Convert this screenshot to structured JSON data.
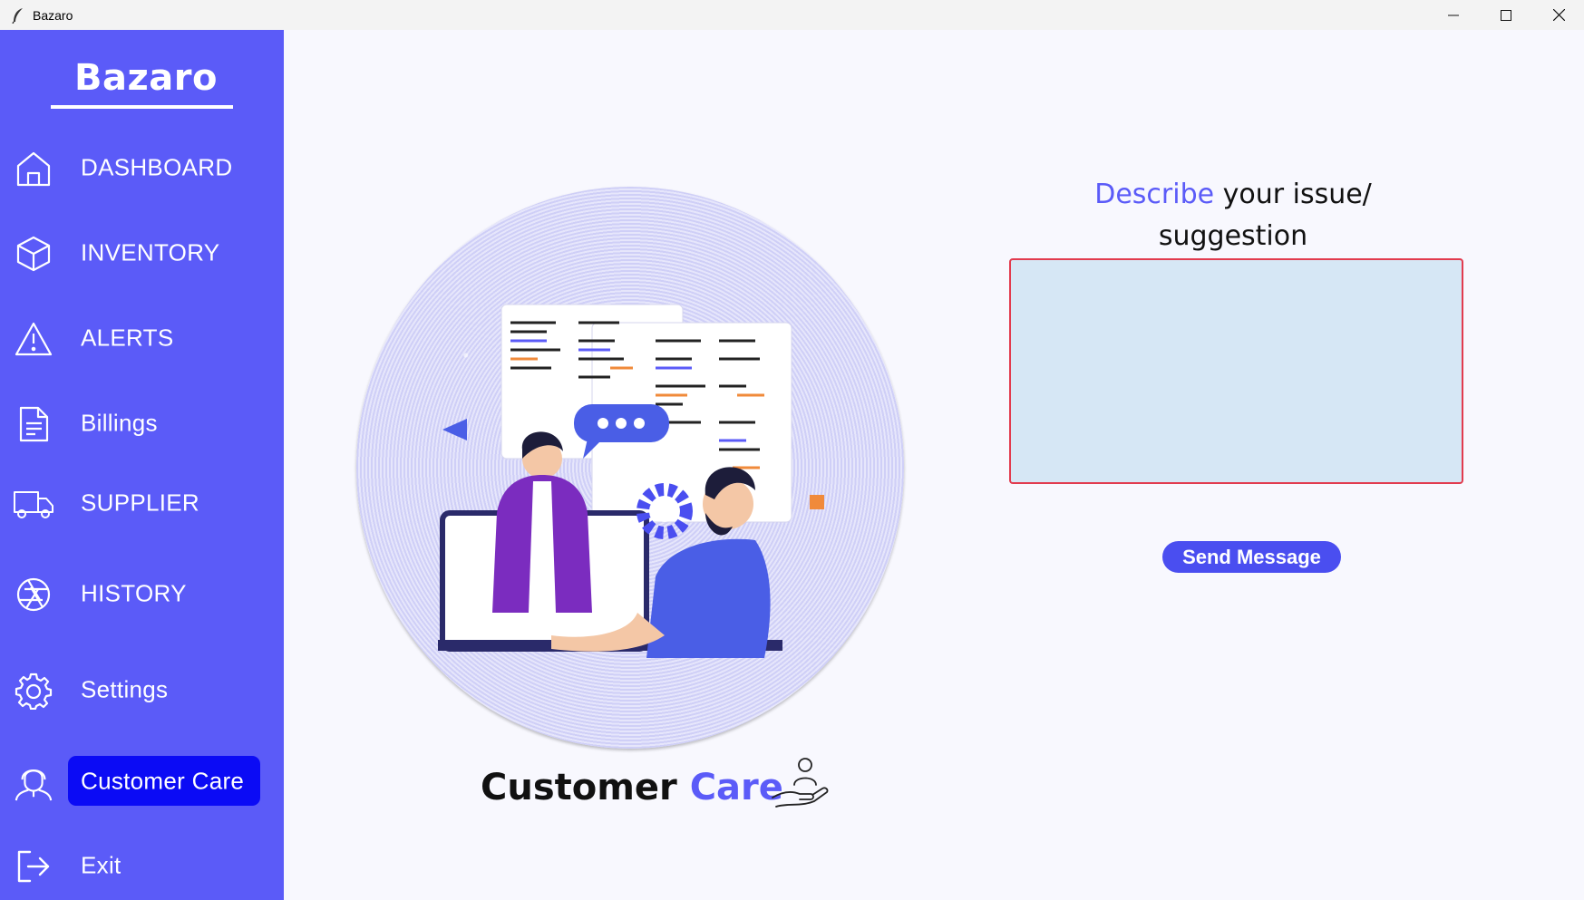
{
  "window": {
    "title": "Bazaro",
    "controls": [
      "minimize-icon",
      "maximize-icon",
      "close-icon"
    ]
  },
  "sidebar": {
    "brand": "Bazaro",
    "items": [
      {
        "label": "DASHBOARD",
        "icon": "home-icon",
        "active": false
      },
      {
        "label": "INVENTORY",
        "icon": "cube-icon",
        "active": false
      },
      {
        "label": "ALERTS",
        "icon": "warning-icon",
        "active": false
      },
      {
        "label": "Billings",
        "icon": "document-icon",
        "active": false
      },
      {
        "label": "SUPPLIER",
        "icon": "truck-icon",
        "active": false
      },
      {
        "label": "HISTORY",
        "icon": "aperture-icon",
        "active": false
      },
      {
        "label": "Settings",
        "icon": "gear-icon",
        "active": false
      },
      {
        "label": "Customer Care",
        "icon": "support-agent-icon",
        "active": true
      },
      {
        "label": "Exit",
        "icon": "logout-icon",
        "active": false
      }
    ]
  },
  "main": {
    "caption_part1": "Customer ",
    "caption_part2": "Care",
    "prompt_accent": "Describe",
    "prompt_rest": " your issue/",
    "prompt_line2": "suggestion",
    "message_value": "",
    "send_label": "Send Message"
  },
  "colors": {
    "sidebar": "#5b5bf8",
    "active_pill": "#0b0bf5",
    "accent": "#5b5bf8",
    "textarea_bg": "#d6e7f5",
    "textarea_border": "#e23b4e",
    "button": "#4a4ef0"
  }
}
